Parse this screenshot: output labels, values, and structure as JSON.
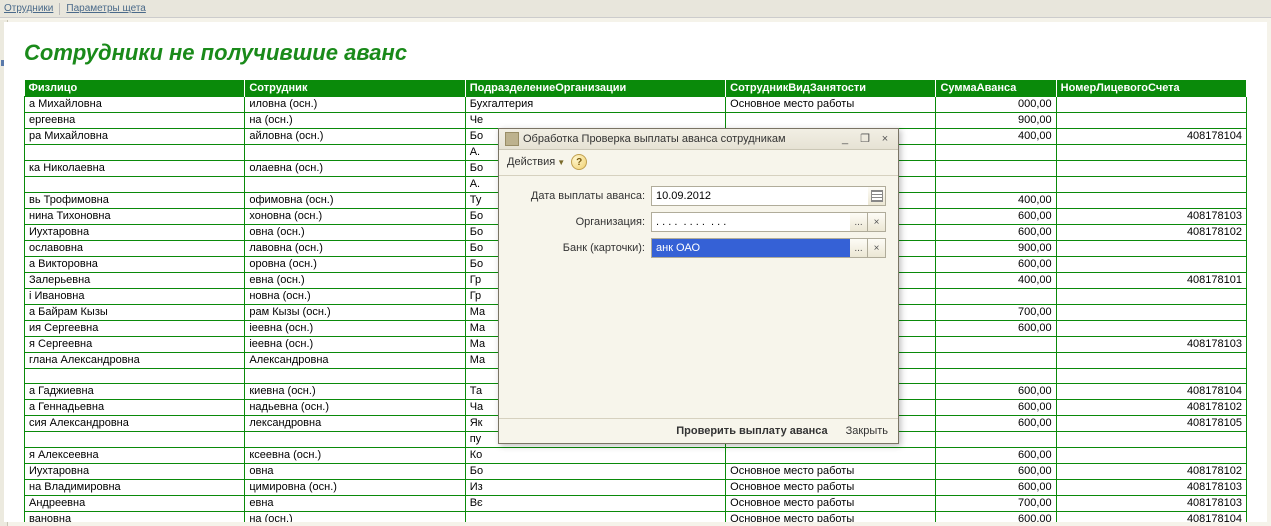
{
  "toolbar": {
    "tab1": "Отрудники",
    "tab2": "Параметры щета"
  },
  "report": {
    "title": "Сотрудники не получившие аванс",
    "columns": [
      "Физлицо",
      "Сотрудник",
      "ПодразделениеОрганизации",
      "СотрудникВидЗанятости",
      "СуммаАванса",
      "НомерЛицевогоСчета"
    ],
    "rows": [
      {
        "f": "а Михайловна",
        "s": "иловна (осн.)",
        "p": "Бухгалтерия",
        "v": "Основное место работы",
        "sum": "000,00",
        "acc": ""
      },
      {
        "f": "ергеевна",
        "s": "на  (осн.)",
        "p": "Че",
        "v": "",
        "sum": "900,00",
        "acc": ""
      },
      {
        "f": "ра Михайловна",
        "s": "айловна  (осн.)",
        "p": "Бо",
        "v": "",
        "sum": "400,00",
        "acc": "408178104"
      },
      {
        "f": "",
        "s": "",
        "p": "А.",
        "v": "",
        "sum": "",
        "acc": ""
      },
      {
        "f": "ка Николаевна",
        "s": "олаевна  (осн.)",
        "p": "Бо",
        "v": "",
        "sum": "",
        "acc": ""
      },
      {
        "f": "",
        "s": "",
        "p": "А.",
        "v": "",
        "sum": "",
        "acc": ""
      },
      {
        "f": "вь Трофимовна",
        "s": "офимовна  (осн.)",
        "p": "Ту",
        "v": "",
        "sum": "400,00",
        "acc": ""
      },
      {
        "f": "нина Тихоновна",
        "s": "хоновна  (осн.)",
        "p": "Бо",
        "v": "",
        "sum": "600,00",
        "acc": "408178103"
      },
      {
        "f": "Иухтаровна",
        "s": "овна  (осн.)",
        "p": "Бо",
        "v": "",
        "sum": "600,00",
        "acc": "408178102"
      },
      {
        "f": "ославовна",
        "s": "лавовна  (осн.)",
        "p": "Бо",
        "v": "",
        "sum": "900,00",
        "acc": ""
      },
      {
        "f": "а Викторовна",
        "s": "оровна  (осн.)",
        "p": "Бо",
        "v": "",
        "sum": "600,00",
        "acc": ""
      },
      {
        "f": "Залерьевна",
        "s": "евна  (осн.)",
        "p": "Гр",
        "v": "",
        "sum": "400,00",
        "acc": "408178101"
      },
      {
        "f": "і Ивановна",
        "s": "новна  (осн.)",
        "p": "Гр",
        "v": "",
        "sum": "",
        "acc": ""
      },
      {
        "f": "а Байрам Кызы",
        "s": "рам Кызы  (осн.)",
        "p": "Ма",
        "v": "",
        "sum": "700,00",
        "acc": ""
      },
      {
        "f": "ия Сергеевна",
        "s": "іеевна  (осн.)",
        "p": "Ма",
        "v": "",
        "sum": "600,00",
        "acc": ""
      },
      {
        "f": "я Сергеевна",
        "s": "іеевна  (осн.)",
        "p": "Ма",
        "v": "",
        "sum": "",
        "acc": "408178103"
      },
      {
        "f": "глана Александровна",
        "s": "Александровна",
        "p": "Ма",
        "v": "",
        "sum": "",
        "acc": ""
      },
      {
        "f": "",
        "s": "",
        "p": "",
        "v": "",
        "sum": "",
        "acc": ""
      },
      {
        "f": "а Гаджиевна",
        "s": "киевна  (осн.)",
        "p": "Та",
        "v": "",
        "sum": "600,00",
        "acc": "408178104"
      },
      {
        "f": "а Геннадьевна",
        "s": "надьевна  (осн.)",
        "p": "Ча",
        "v": "",
        "sum": "600,00",
        "acc": "408178102"
      },
      {
        "f": "сия Александровна",
        "s": "лександровна",
        "p": "Як",
        "v": "",
        "sum": "600,00",
        "acc": "408178105"
      },
      {
        "f": "",
        "s": "",
        "p": "пу",
        "v": "",
        "sum": "",
        "acc": ""
      },
      {
        "f": "я Алексеевна",
        "s": "ксеевна  (осн.)",
        "p": "Ко",
        "v": "",
        "sum": "600,00",
        "acc": ""
      },
      {
        "f": "Иухтаровна",
        "s": "овна",
        "p": "Бо",
        "v": "Основное место работы",
        "sum": "600,00",
        "acc": "408178102"
      },
      {
        "f": "на Владимировна",
        "s": "цимировна  (осн.)",
        "p": "Из",
        "v": "Основное место работы",
        "sum": "600,00",
        "acc": "408178103"
      },
      {
        "f": "Андреевна",
        "s": "евна",
        "p": "Вє",
        "v": "Основное место работы",
        "sum": "700,00",
        "acc": "408178103"
      },
      {
        "f": "вановна",
        "s": "на  (осн.)",
        "p": "",
        "v": "Основное место работы",
        "sum": "600,00",
        "acc": "408178104"
      }
    ]
  },
  "dialog": {
    "title": "Обработка  Проверка выплаты аванса сотрудникам",
    "actions": "Действия",
    "fields": {
      "date_label": "Дата выплаты аванса:",
      "date_value": "10.09.2012",
      "org_label": "Организация:",
      "org_value": ". . . .  . . . .  . . .",
      "bank_label": "Банк (карточки):",
      "bank_value": "анк ОАО"
    },
    "buttons": {
      "check": "Проверить выплату аванса",
      "close": "Закрыть"
    },
    "dots": "...",
    "x": "×"
  }
}
